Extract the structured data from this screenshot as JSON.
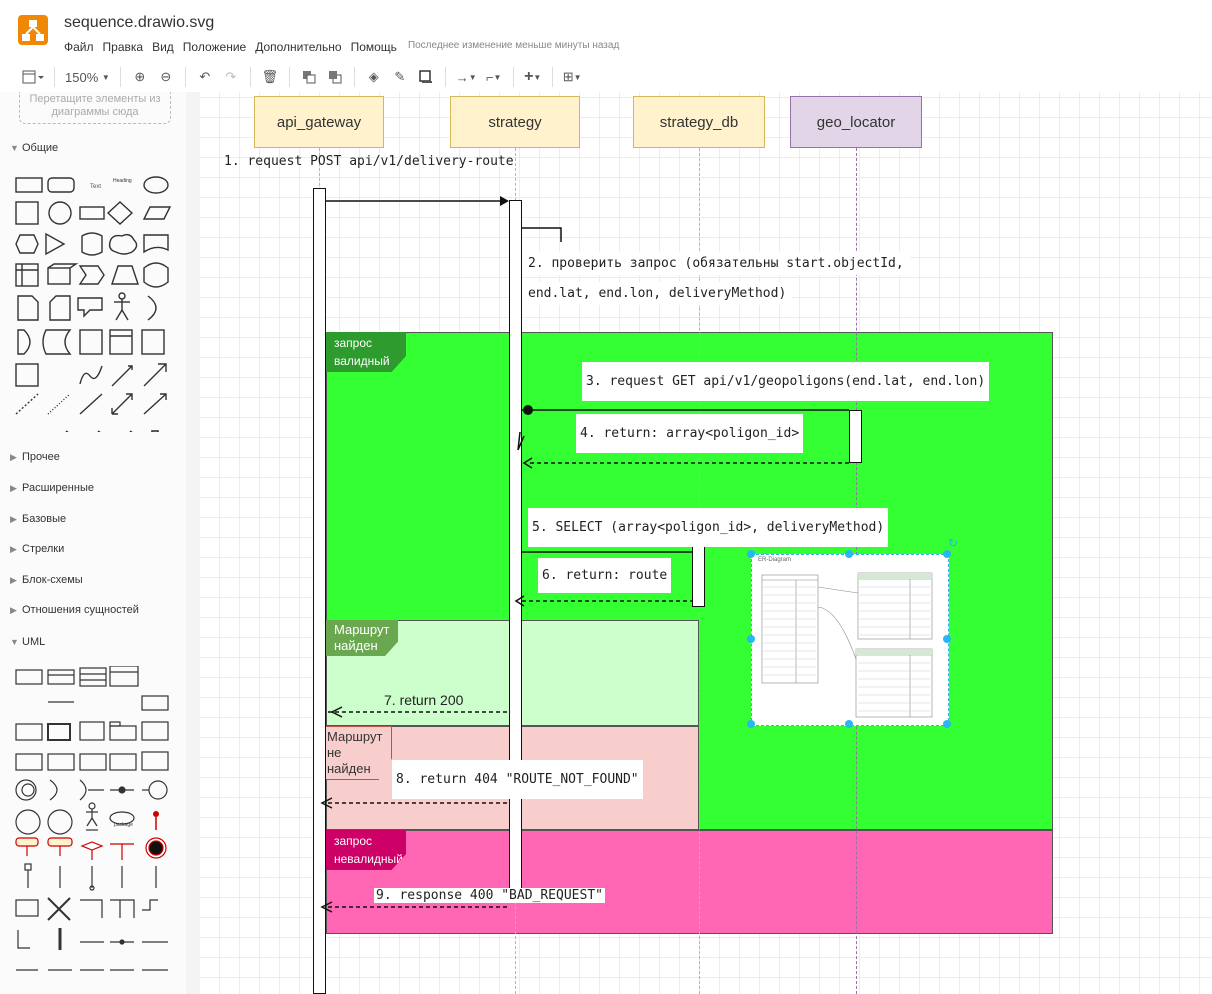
{
  "header": {
    "file_name": "sequence.drawio.svg",
    "menu": [
      "Файл",
      "Правка",
      "Вид",
      "Положение",
      "Дополнительно",
      "Помощь"
    ],
    "last_change": "Последнее изменение меньше минуты назад"
  },
  "toolbar": {
    "zoom": "150%",
    "icons": [
      "format-panel-icon",
      "zoom-in-icon",
      "zoom-out-icon",
      "undo-icon",
      "redo-icon",
      "delete-icon",
      "to-front-icon",
      "to-back-icon",
      "fill-color-icon",
      "line-color-icon",
      "shadow-icon",
      "connection-icon",
      "waypoints-icon",
      "insert-icon",
      "table-icon"
    ]
  },
  "sidebar": {
    "dropzone_text": "Перетащите элементы из диаграммы сюда",
    "sections": [
      {
        "label": "Общие",
        "expanded": true
      },
      {
        "label": "Прочее",
        "expanded": false
      },
      {
        "label": "Расширенные",
        "expanded": false
      },
      {
        "label": "Базовые",
        "expanded": false
      },
      {
        "label": "Стрелки",
        "expanded": false
      },
      {
        "label": "Блок-схемы",
        "expanded": false
      },
      {
        "label": "Отношения сущностей",
        "expanded": false
      },
      {
        "label": "UML",
        "expanded": true
      }
    ],
    "shape_labels": {
      "text": "Text",
      "heading": "Heading",
      "package": "package"
    }
  },
  "diagram": {
    "actors": [
      {
        "label": "api_gateway",
        "fill": "#fff2cc",
        "stroke": "#d6b656"
      },
      {
        "label": "strategy",
        "fill": "#fff2cc",
        "stroke": "#d6b656"
      },
      {
        "label": "strategy_db",
        "fill": "#fff2cc",
        "stroke": "#d6b656"
      },
      {
        "label": "geo_locator",
        "fill": "#e1d5e7",
        "stroke": "#9673a6"
      }
    ],
    "messages": [
      "1. request POST api/v1/delivery-route",
      "2. проверить запрос (обязательны  start.objectId,",
      "end.lat, end.lon, deliveryMethod)",
      "3. request GET api/v1/geopoligons(end.lat, end.lon)",
      "4. return: array<poligon_id>",
      "5. SELECT (array<poligon_id>,  deliveryMethod)",
      "6. return: route",
      "7. return 200",
      "8. return 404 \"ROUTE_NOT_FOUND\"",
      "9. response 400 \"BAD_REQUEST\""
    ],
    "frames": [
      {
        "label": "запрос валидный",
        "fill": "#33ff33",
        "tab_color": "#2d9b2d"
      },
      {
        "label": "Маршрут найден",
        "fill": "#ccffcc",
        "tab_color": "#6aa84f"
      },
      {
        "label": "Маршрут не найден",
        "fill": "#f8cecc",
        "tab_color": "#b85450"
      },
      {
        "label": "запрос невалидный",
        "fill": "#ff66b3",
        "tab_color": "#cc0066"
      }
    ],
    "embedded_image_title": "ER-Diagram"
  }
}
